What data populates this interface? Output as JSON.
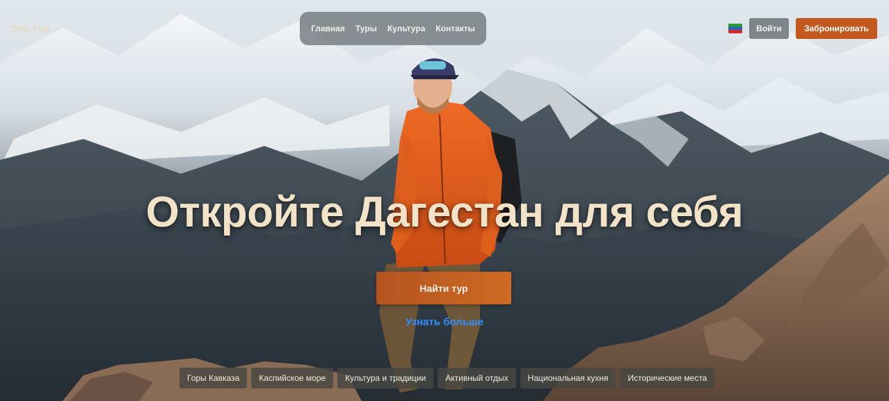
{
  "header": {
    "logo": "Зов Гор",
    "nav": [
      "Главная",
      "Туры",
      "Культура",
      "Контакты"
    ],
    "flag_colors": [
      "#2a9a3c",
      "#2466c8",
      "#d32a2a"
    ],
    "login_label": "Войти",
    "book_label": "Забронировать"
  },
  "hero": {
    "title": "Откройте Дагестан для себя",
    "cta_label": "Найти тур",
    "more_link": "Узнать больше"
  },
  "categories": [
    "Горы Кавказа",
    "Каспийское море",
    "Культура и традиции",
    "Активный отдых",
    "Национальная кухня",
    "Исторические места"
  ],
  "colors": {
    "accent": "#c3591f",
    "title": "#f2e3c8",
    "link": "#2f8fff"
  }
}
